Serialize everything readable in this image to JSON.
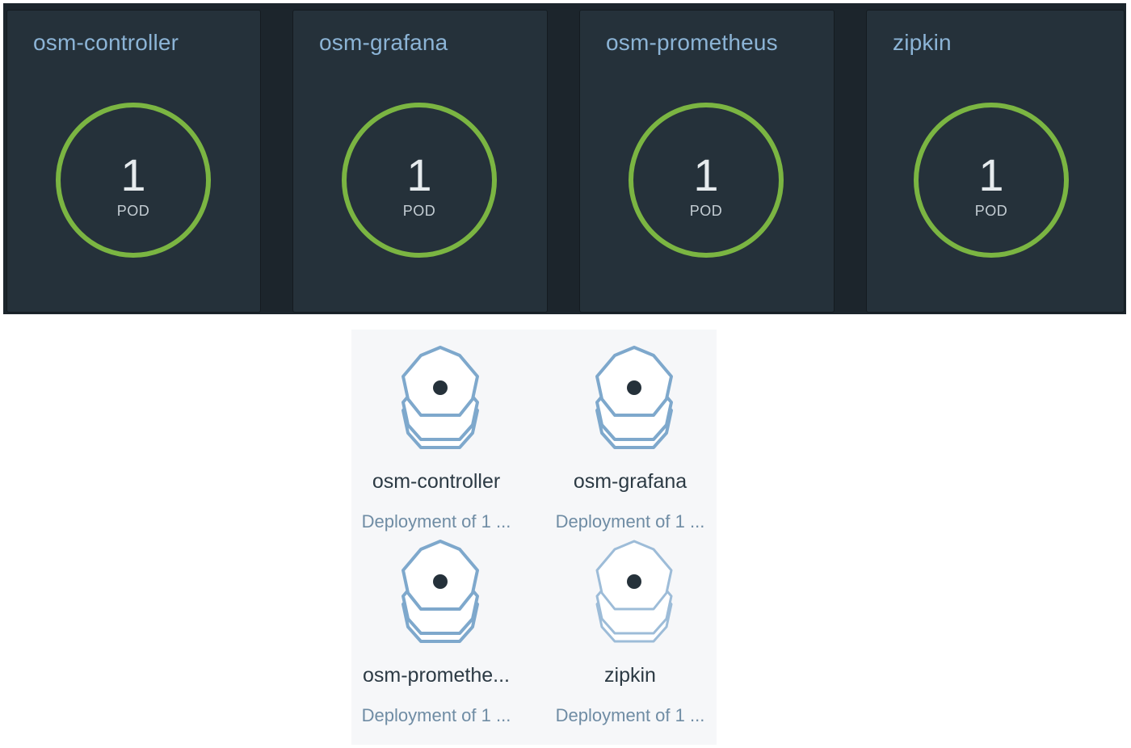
{
  "summary_cards": [
    {
      "name": "osm-controller",
      "count": "1",
      "unit": "POD"
    },
    {
      "name": "osm-grafana",
      "count": "1",
      "unit": "POD"
    },
    {
      "name": "osm-prometheus",
      "count": "1",
      "unit": "POD"
    },
    {
      "name": "zipkin",
      "count": "1",
      "unit": "POD"
    }
  ],
  "deployments": [
    {
      "name": "osm-controller",
      "subtitle": "Deployment of 1 ...",
      "icon": "deployment-stack-icon"
    },
    {
      "name": "osm-grafana",
      "subtitle": "Deployment of 1 ...",
      "icon": "deployment-stack-icon"
    },
    {
      "name": "osm-promethe...",
      "subtitle": "Deployment of 1 ...",
      "icon": "deployment-stack-icon"
    },
    {
      "name": "zipkin",
      "subtitle": "Deployment of 1 ...",
      "icon": "deployment-stack-icon"
    }
  ],
  "colors": {
    "card_bg": "#25313a",
    "strip_bg": "#1c252c",
    "title": "#8cb4d6",
    "ring": "#7bb542",
    "icon_stroke": "#7ea8cc",
    "panel_bg": "#f6f7f9"
  }
}
